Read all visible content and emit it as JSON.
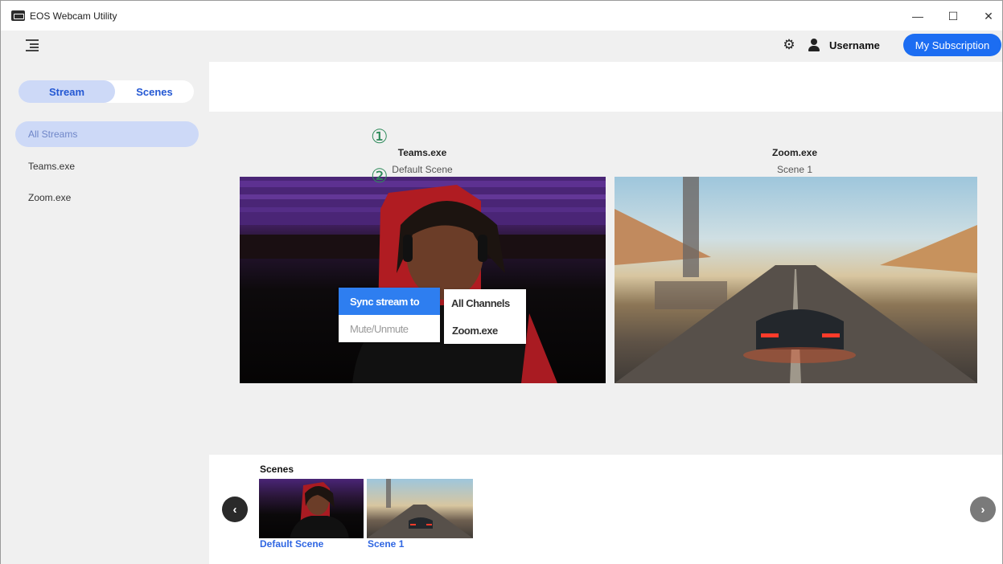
{
  "app": {
    "title": "EOS Webcam Utility"
  },
  "window_controls": {
    "minimize": "—",
    "maximize": "☐",
    "close": "✕"
  },
  "toolbar": {
    "username": "Username",
    "subscription_label": "My Subscription"
  },
  "sidebar": {
    "tabs": [
      {
        "label": "Stream",
        "active": true
      },
      {
        "label": "Scenes",
        "active": false
      }
    ],
    "items": [
      {
        "label": "All Streams",
        "active": true
      },
      {
        "label": "Teams.exe"
      },
      {
        "label": "Zoom.exe"
      }
    ]
  },
  "streams": [
    {
      "title": "Teams.exe",
      "scene": "Default Scene"
    },
    {
      "title": "Zoom.exe",
      "scene": "Scene 1"
    }
  ],
  "markers": [
    "①",
    "②"
  ],
  "context_menu": {
    "items": [
      {
        "label": "Sync stream to",
        "highlighted": true
      },
      {
        "label": "Mute/Unmute",
        "disabled": true
      }
    ],
    "submenu": [
      {
        "label": "All Channels"
      },
      {
        "label": "Zoom.exe"
      }
    ]
  },
  "scenes_panel": {
    "title": "Scenes",
    "prev": "‹",
    "next": "›",
    "scenes": [
      {
        "label": "Default Scene"
      },
      {
        "label": "Scene 1"
      }
    ]
  },
  "colors": {
    "accent": "#1c6df2",
    "selected_bg": "#cdd9f7",
    "scene_label": "#2f66e2"
  }
}
